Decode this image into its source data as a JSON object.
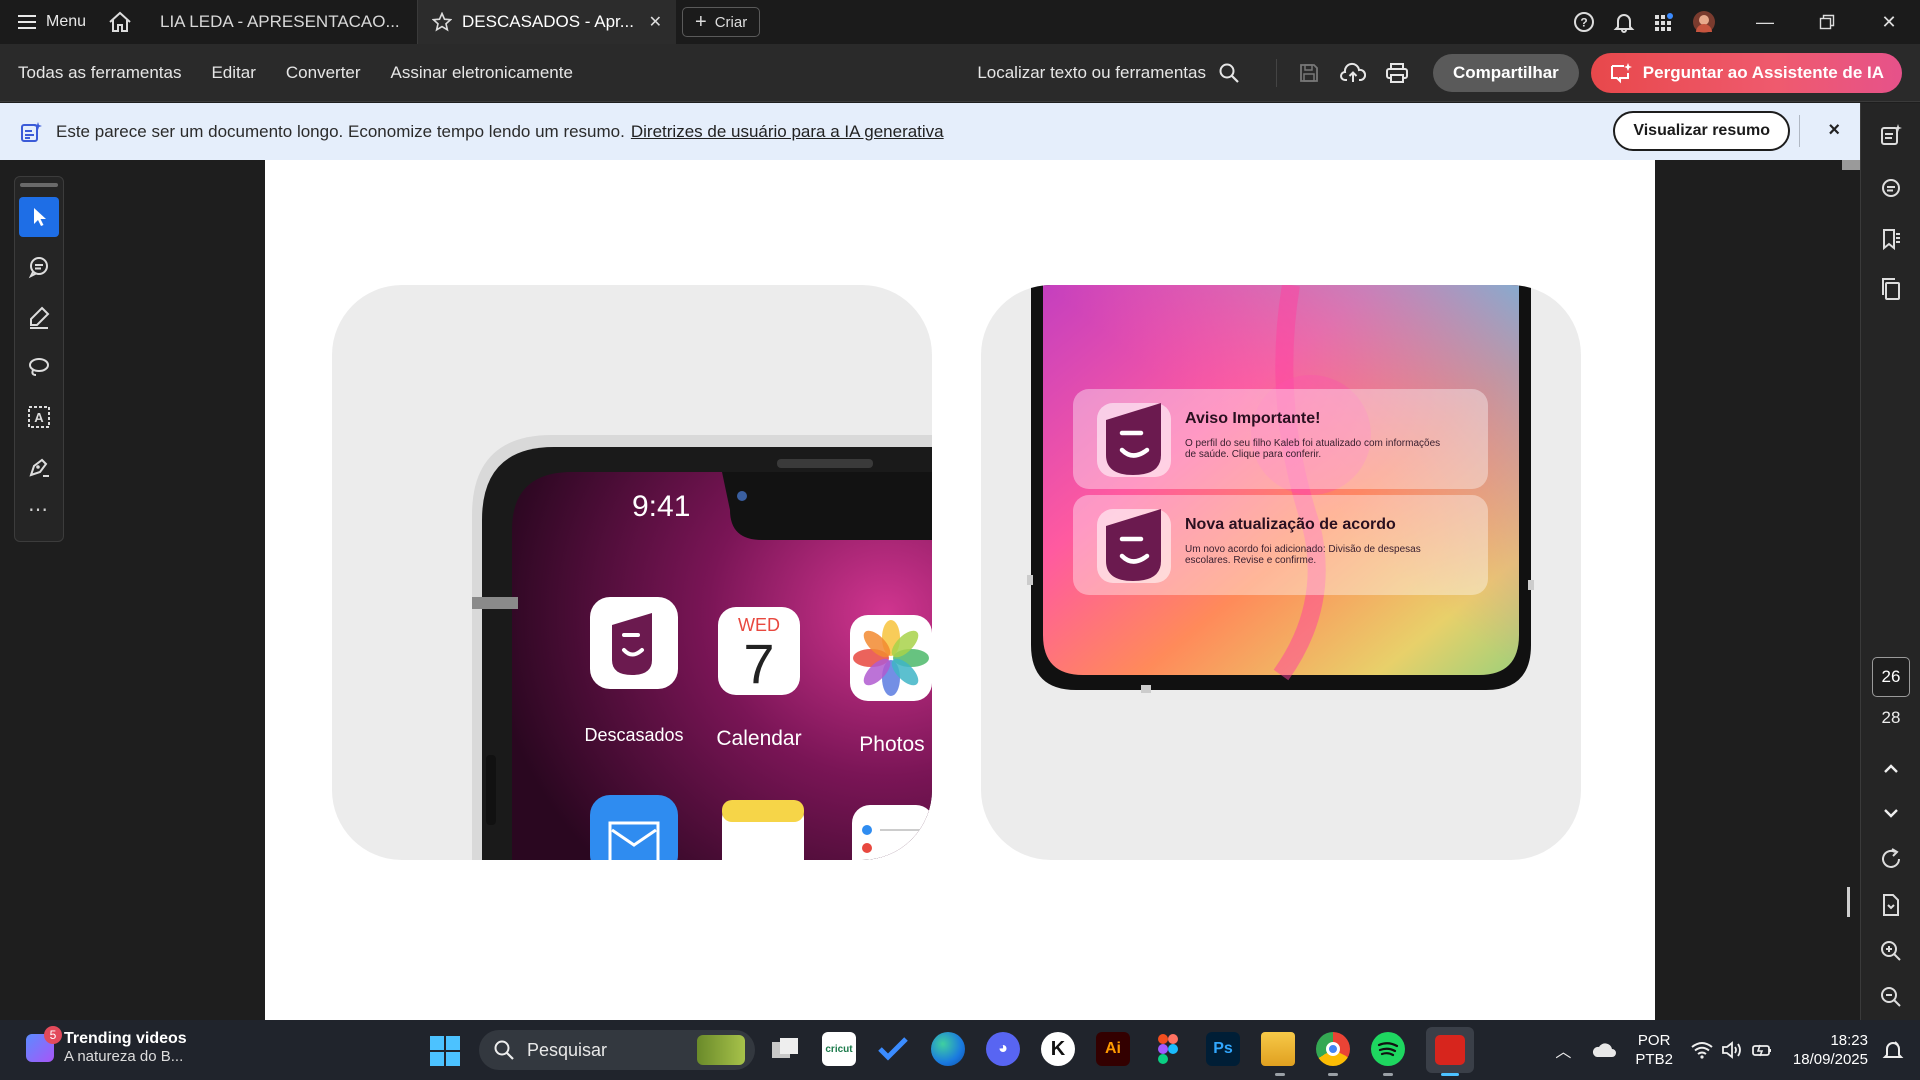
{
  "titlebar": {
    "menu_label": "Menu",
    "tabs": [
      {
        "label": "LIA LEDA - APRESENTACAO..."
      },
      {
        "label": "DESCASADOS - Apr..."
      }
    ],
    "create_label": "Criar"
  },
  "toolbar": {
    "items": [
      "Todas as ferramentas",
      "Editar",
      "Converter",
      "Assinar eletronicamente"
    ],
    "find_label": "Localizar texto ou ferramentas",
    "share_label": "Compartilhar",
    "ai_label": "Perguntar ao Assistente de IA"
  },
  "banner": {
    "text": "Este parece ser um documento longo. Economize tempo lendo um resumo.",
    "link": "Diretrizes de usuário para a IA generativa",
    "button": "Visualizar resumo",
    "close": "×"
  },
  "document": {
    "phone_left": {
      "time": "9:41",
      "apps": [
        {
          "label": "Descasados"
        },
        {
          "label": "Calendar",
          "day": "WED",
          "date": "7"
        },
        {
          "label": "Photos"
        }
      ]
    },
    "phone_right": {
      "notifications": [
        {
          "title": "Aviso Importante!",
          "body_line1": "O perfil do seu filho Kaleb foi atualizado com informações",
          "body_line2": "de saúde. Clique para conferir."
        },
        {
          "title": "Nova atualização de acordo",
          "body_line1": "Um novo acordo foi adicionado: Divisão de despesas",
          "body_line2": "escolares. Revise e confirme."
        }
      ]
    }
  },
  "pagination": {
    "current": "26",
    "total": "28"
  },
  "taskbar": {
    "widget_badge": "5",
    "widget_title": "Trending videos",
    "widget_subtitle": "A natureza do B...",
    "search_label": "Pesquisar",
    "lang_line1": "POR",
    "lang_line2": "PTB2",
    "time": "18:23",
    "date": "18/09/2025"
  },
  "colors": {
    "accent_blue": "#1e6ee6",
    "ai_gradient_start": "#e8484b",
    "brand_purple": "#6b1a4f",
    "banner_bg": "#e5eefb"
  }
}
